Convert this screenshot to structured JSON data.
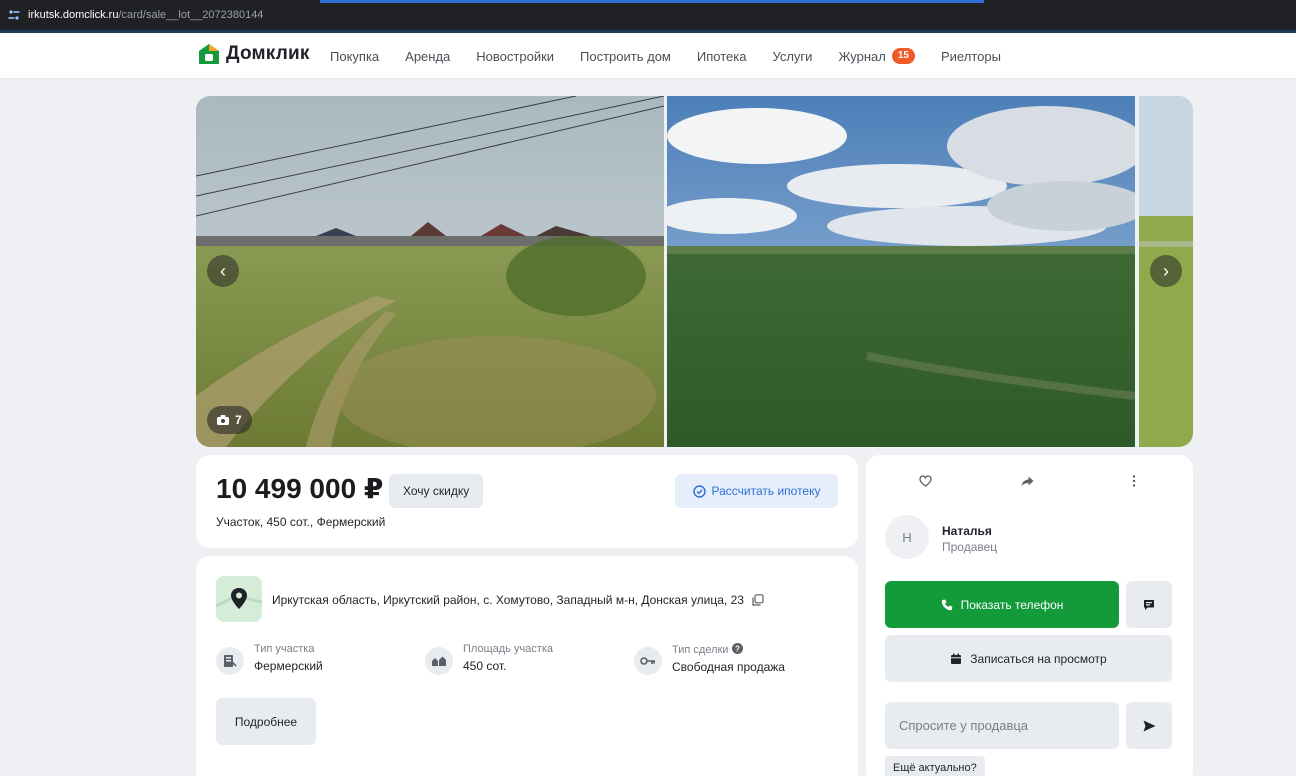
{
  "browser": {
    "domain": "irkutsk.domclick.ru",
    "path": "/card/sale__lot__2072380144"
  },
  "header": {
    "logo": "Домклик",
    "nav": [
      {
        "label": "Покупка"
      },
      {
        "label": "Аренда"
      },
      {
        "label": "Новостройки"
      },
      {
        "label": "Построить дом"
      },
      {
        "label": "Ипотека"
      },
      {
        "label": "Услуги"
      },
      {
        "label": "Журнал",
        "badge": "15"
      },
      {
        "label": "Риелторы"
      }
    ],
    "brand_color": "#139a3a",
    "badge_color": "#f05a28"
  },
  "gallery": {
    "photo_count": "7",
    "prev_icon": "chevron-left-icon",
    "next_icon": "chevron-right-icon"
  },
  "listing": {
    "price": "10 499 000 ₽",
    "discount_button": "Хочу скидку",
    "mortgage_button": "Рассчитать ипотеку",
    "subtitle": "Участок, 450 сот., Фермерский",
    "address": "Иркутская область, Иркутский район, с. Хомутово, Западный м-н, Донская улица, 23",
    "props": [
      {
        "label": "Тип участка",
        "value": "Фермерский",
        "icon": "plot-type-icon"
      },
      {
        "label": "Площадь участка",
        "value": "450 сот.",
        "icon": "area-icon"
      },
      {
        "label": "Тип сделки",
        "value": "Свободная продажа",
        "icon": "key-icon"
      }
    ],
    "more_button": "Подробнее"
  },
  "seller": {
    "initial": "Н",
    "name": "Наталья",
    "role": "Продавец",
    "phone_button": "Показать телефон",
    "visit_button": "Записаться на просмотр",
    "ask_placeholder": "Спросите у продавца",
    "chip": "Ещё актуально?"
  }
}
